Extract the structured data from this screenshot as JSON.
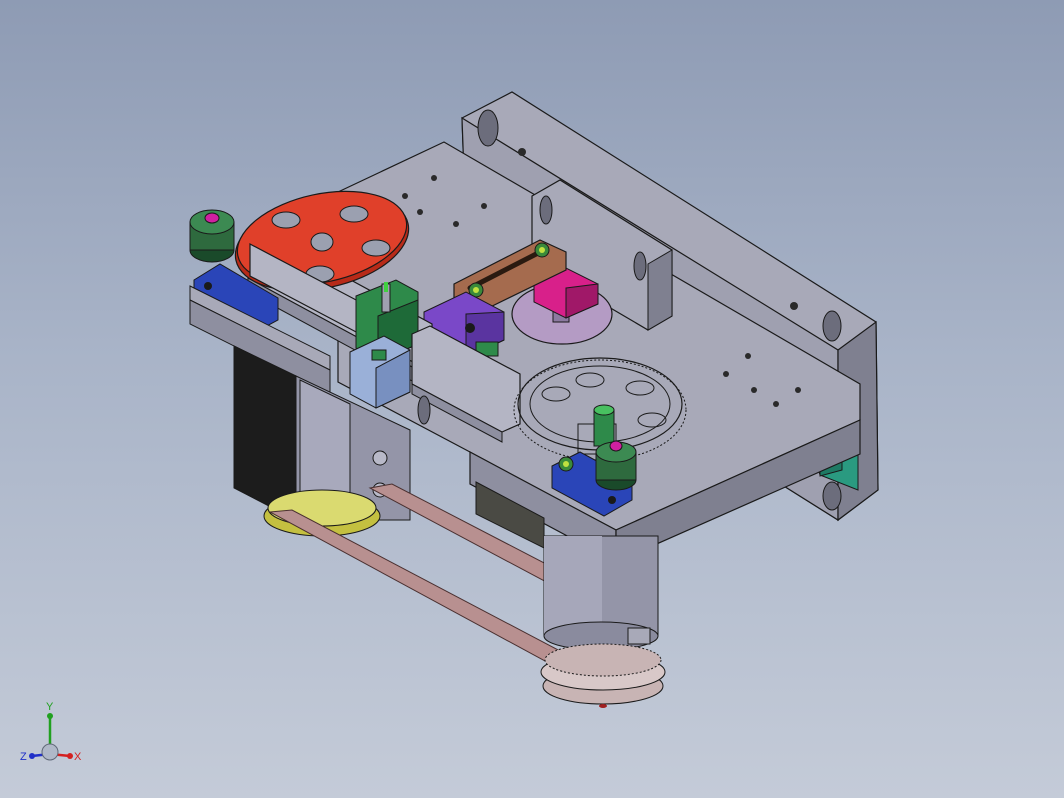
{
  "viewport": {
    "background_top": "#8e9bb4",
    "background_bottom": "#c4cbd8"
  },
  "triad": {
    "x_label": "X",
    "y_label": "Y",
    "z_label": "Z",
    "x_color": "#d42020",
    "y_color": "#20a020",
    "z_color": "#2030c8"
  },
  "colors": {
    "plate": "#a8a9b8",
    "plate_dark": "#7f8090",
    "handwheel": "#e0402a",
    "crank": "#a56b4e",
    "magenta_block": "#d8208a",
    "green_block": "#2e8a4a",
    "violet_block": "#7a48c8",
    "blue_arm": "#2a45b8",
    "teal_bracket": "#2a9a80",
    "belt": "#b89090",
    "motor_black": "#1c1c1c",
    "motor_grey": "#9495a8"
  }
}
